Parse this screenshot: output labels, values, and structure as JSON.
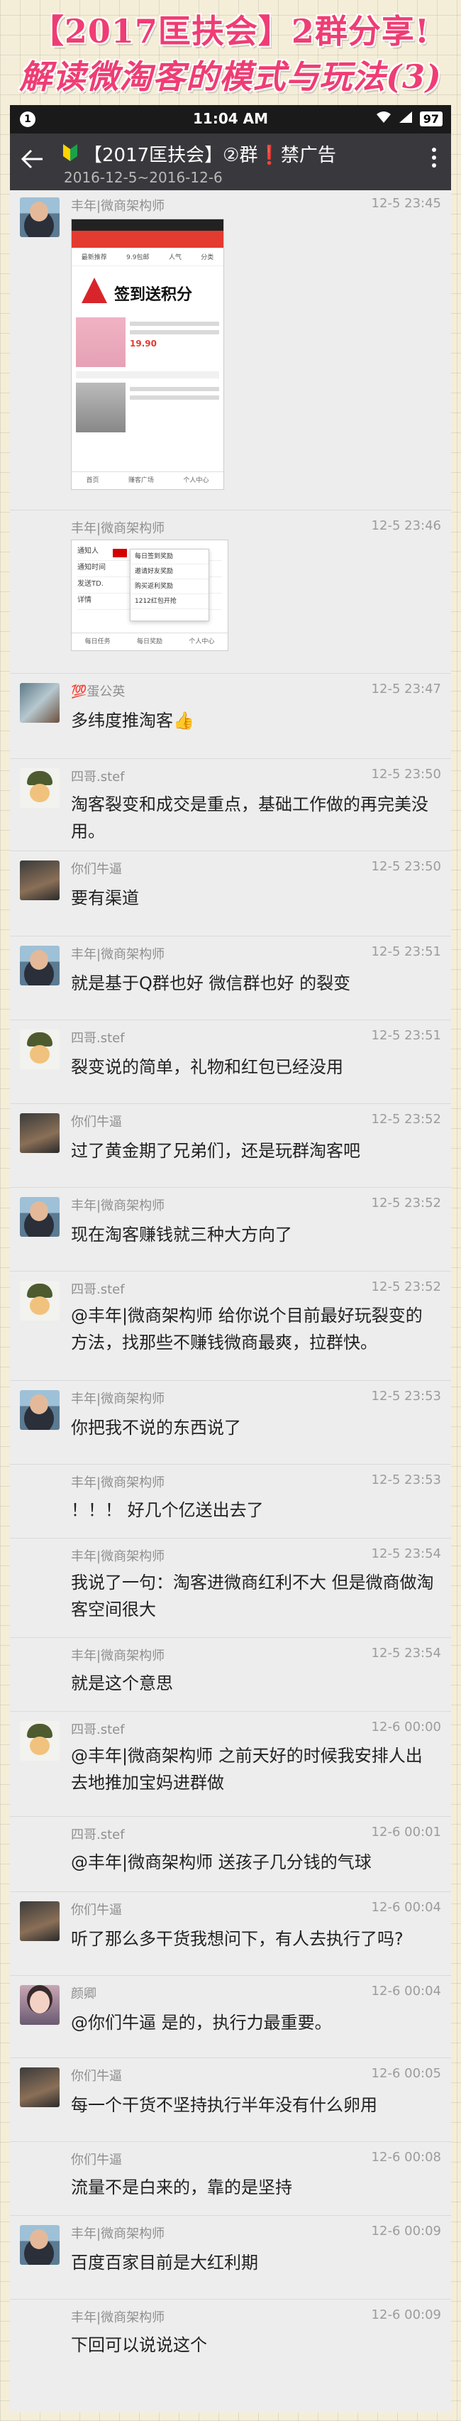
{
  "banner": {
    "line1": "【2017匡扶会】2群分享!",
    "line2": "解读微淘客的模式与玩法(3)"
  },
  "statusbar": {
    "notification": "1",
    "time": "11:04 AM",
    "battery": "97"
  },
  "header": {
    "title": "【2017匡扶会】②群❗禁广告",
    "subtitle": "2016-12-5~2016-12-6"
  },
  "messages": [
    {
      "name": "丰年|微商架构师",
      "time": "12-5 23:45",
      "text": ""
    },
    {
      "name": "丰年|微商架构师",
      "time": "12-5 23:46",
      "text": ""
    },
    {
      "name": "💯蛋公英",
      "time": "12-5 23:47",
      "text": "多纬度推淘客👍"
    },
    {
      "name": "四哥.stef",
      "time": "12-5 23:50",
      "text": "淘客裂变和成交是重点，基础工作做的再完美没用。"
    },
    {
      "name": "你们牛逼",
      "time": "12-5 23:50",
      "text": "要有渠道"
    },
    {
      "name": "丰年|微商架构师",
      "time": "12-5 23:51",
      "text": "就是基于Q群也好 微信群也好 的裂变"
    },
    {
      "name": "四哥.stef",
      "time": "12-5 23:51",
      "text": "裂变说的简单，礼物和红包已经没用"
    },
    {
      "name": "你们牛逼",
      "time": "12-5 23:52",
      "text": "过了黄金期了兄弟们，还是玩群淘客吧"
    },
    {
      "name": "丰年|微商架构师",
      "time": "12-5 23:52",
      "text": "现在淘客赚钱就三种大方向了"
    },
    {
      "name": "四哥.stef",
      "time": "12-5 23:52",
      "text": "@丰年|微商架构师 给你说个目前最好玩裂变的方法，找那些不赚钱微商最爽，拉群快。"
    },
    {
      "name": "丰年|微商架构师",
      "time": "12-5 23:53",
      "text": "你把我不说的东西说了"
    },
    {
      "name": "丰年|微商架构师",
      "time": "12-5 23:53",
      "text": "！！！ 好几个亿送出去了"
    },
    {
      "name": "丰年|微商架构师",
      "time": "12-5 23:54",
      "text": "我说了一句：淘客进微商红利不大 但是微商做淘客空间很大"
    },
    {
      "name": "丰年|微商架构师",
      "time": "12-5 23:54",
      "text": "就是这个意思"
    },
    {
      "name": "四哥.stef",
      "time": "12-6 00:00",
      "text": "@丰年|微商架构师 之前天好的时候我安排人出去地推加宝妈进群做"
    },
    {
      "name": "四哥.stef",
      "time": "12-6 00:01",
      "text": "@丰年|微商架构师 送孩子几分钱的气球"
    },
    {
      "name": "你们牛逼",
      "time": "12-6 00:04",
      "text": "听了那么多干货我想问下，有人去执行了吗?"
    },
    {
      "name": "颜卿",
      "time": "12-6 00:04",
      "text": "@你们牛逼 是的，执行力最重要。"
    },
    {
      "name": "你们牛逼",
      "time": "12-6 00:05",
      "text": "每一个干货不坚持执行半年没有什么卵用"
    },
    {
      "name": "你们牛逼",
      "time": "12-6 00:08",
      "text": "流量不是白来的，靠的是坚持"
    },
    {
      "name": "丰年|微商架构师",
      "time": "12-6 00:09",
      "text": "百度百家目前是大红利期"
    },
    {
      "name": "丰年|微商架构师",
      "time": "12-6 00:09",
      "text": "下回可以说说这个"
    }
  ],
  "screenshot1": {
    "tabs": [
      "最新推荐",
      "9.9包邮",
      "人气",
      "分类"
    ],
    "sign_text": "签到送积分",
    "price": "19.90",
    "footer": [
      "首页",
      "赚客广场",
      "个人中心"
    ]
  },
  "screenshot2": {
    "rows": [
      "通知人",
      "通知时间",
      "发送TD.",
      "详情"
    ],
    "panel": [
      "每日签到奖励",
      "邀请好友奖励",
      "购买返利奖励",
      "1212红包开抢"
    ],
    "footer": [
      "每日任务",
      "每日奖励",
      "个人中心"
    ]
  }
}
